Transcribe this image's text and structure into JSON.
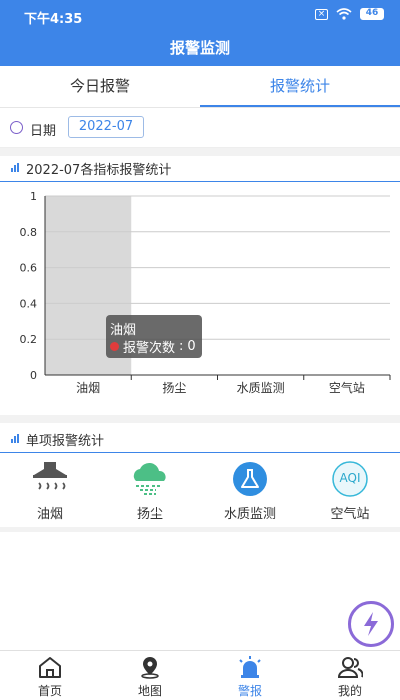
{
  "status_bar": {
    "time": "下午4:35",
    "battery": "46"
  },
  "header": {
    "title": "报警监测"
  },
  "tabs": [
    {
      "label": "今日报警",
      "active": false
    },
    {
      "label": "报警统计",
      "active": true
    }
  ],
  "date_filter": {
    "label": "日期",
    "value": "2022-07"
  },
  "chart_section": {
    "title": "2022-07各指标报警统计"
  },
  "chart_data": {
    "type": "bar",
    "categories": [
      "油烟",
      "扬尘",
      "水质监测",
      "空气站"
    ],
    "series": [
      {
        "name": "报警次数",
        "values": [
          0,
          0,
          0,
          0
        ]
      }
    ],
    "ylim": [
      0,
      1
    ],
    "yticks": [
      0,
      0.2,
      0.4,
      0.6,
      0.8,
      1
    ],
    "highlighted_category": "油烟",
    "tooltip": {
      "category": "油烟",
      "series_label": "报警次数",
      "value": "0"
    }
  },
  "single_section": {
    "title": "单项报警统计"
  },
  "items": [
    {
      "label": "油烟",
      "icon": "range-hood-icon"
    },
    {
      "label": "扬尘",
      "icon": "dust-cloud-icon"
    },
    {
      "label": "水质监测",
      "icon": "flask-icon"
    },
    {
      "label": "空气站",
      "icon": "aqi-icon",
      "icon_text": "AQI"
    }
  ],
  "nav": [
    {
      "label": "首页",
      "icon": "home-icon",
      "active": false
    },
    {
      "label": "地图",
      "icon": "map-pin-icon",
      "active": false
    },
    {
      "label": "警报",
      "icon": "alarm-light-icon",
      "active": true
    },
    {
      "label": "我的",
      "icon": "user-icon",
      "active": false
    }
  ],
  "colors": {
    "primary": "#3d85e8",
    "highlight": "#d9d9d9",
    "fab": "#8b6ad8",
    "alert_dot": "#e03c3c"
  }
}
